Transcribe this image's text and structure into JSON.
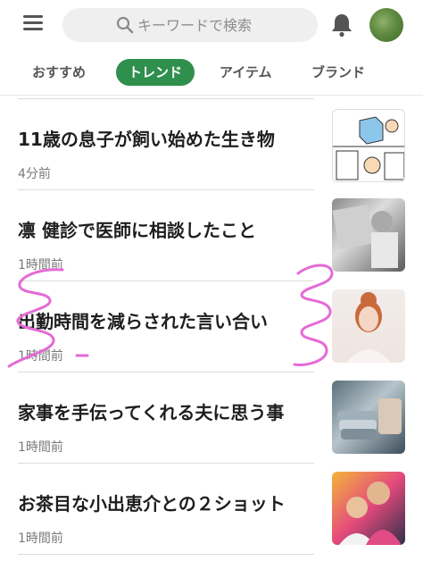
{
  "header": {
    "search_placeholder": "キーワードで検索",
    "icons": [
      "menu-icon",
      "search-icon",
      "bell-icon",
      "avatar"
    ]
  },
  "tabs": [
    {
      "label": "おすすめ",
      "active": false
    },
    {
      "label": "トレンド",
      "active": true
    },
    {
      "label": "アイテム",
      "active": false
    },
    {
      "label": "ブランド",
      "active": false
    }
  ],
  "articles": [
    {
      "title": "11歳の息子が飼い始めた生き物",
      "time": "4分前"
    },
    {
      "title": "凛 健診で医師に相談したこと",
      "time": "1時間前"
    },
    {
      "title": "出勤時間を減らされた言い合い",
      "time": "1時間前"
    },
    {
      "title": "家事を手伝ってくれる夫に思う事",
      "time": "1時間前"
    },
    {
      "title": "お茶目な小出恵介との２ショット",
      "time": "1時間前"
    }
  ],
  "colors": {
    "accent": "#2f8f4d",
    "doodle": "#e56ad6"
  }
}
